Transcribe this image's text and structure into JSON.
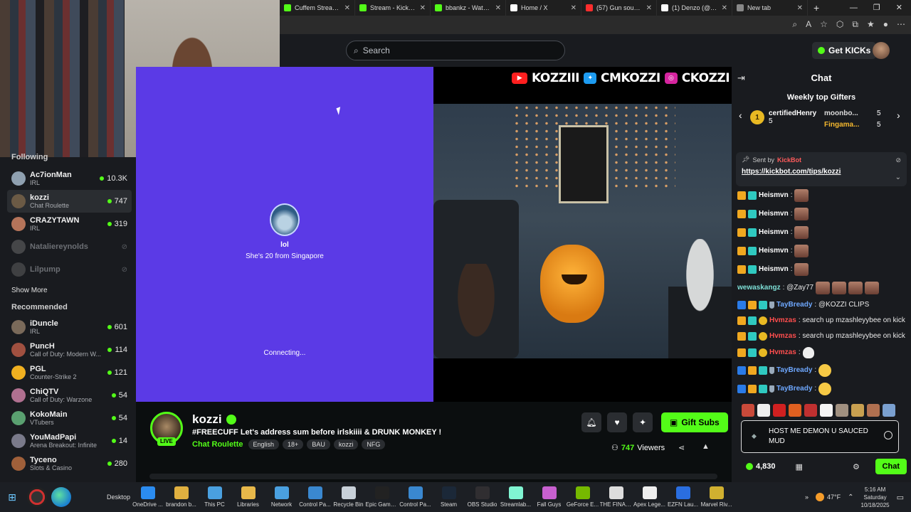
{
  "browser": {
    "tabs": [
      {
        "title": "Cuffem Stream - V",
        "color": "#53fc18"
      },
      {
        "title": "Stream - Kick Dash",
        "color": "#53fc18"
      },
      {
        "title": "bbankz - Watch th",
        "color": "#53fc18"
      },
      {
        "title": "Home / X",
        "color": "#ffffff"
      },
      {
        "title": "(57) Gun sound ef",
        "color": "#ff2d2d"
      },
      {
        "title": "(1) Denzo (@Denz",
        "color": "#ffffff"
      },
      {
        "title": "New tab",
        "color": "#888888"
      }
    ]
  },
  "header": {
    "search_placeholder": "Search",
    "get_kicks": "Get KICKs"
  },
  "sidebar": {
    "following_label": "Following",
    "following": [
      {
        "name": "Ac7ionMan",
        "category": "IRL",
        "viewers": "10.3K",
        "live": true,
        "color": "#8fa0b0"
      },
      {
        "name": "kozzi",
        "category": "Chat Roulette",
        "viewers": "747",
        "live": true,
        "color": "#6b5a45"
      },
      {
        "name": "CRAZYTAWN",
        "category": "IRL",
        "viewers": "319",
        "live": true,
        "color": "#b5745a"
      },
      {
        "name": "Nataliereynolds",
        "category": "",
        "viewers": "",
        "live": false,
        "color": "#888"
      },
      {
        "name": "Lilpump",
        "category": "",
        "viewers": "",
        "live": false,
        "color": "#777"
      }
    ],
    "show_more": "Show More",
    "recommended_label": "Recommended",
    "recommended": [
      {
        "name": "iDuncle",
        "category": "IRL",
        "viewers": "601",
        "color": "#7a6a5a"
      },
      {
        "name": "PuncH",
        "category": "Call of Duty: Modern W...",
        "viewers": "114",
        "color": "#a05040"
      },
      {
        "name": "PGL",
        "category": "Counter-Strike 2",
        "viewers": "121",
        "color": "#f0b020"
      },
      {
        "name": "ChiQTV",
        "category": "Call of Duty: Warzone",
        "viewers": "54",
        "color": "#b07090"
      },
      {
        "name": "KokoMain",
        "category": "VTubers",
        "viewers": "54",
        "color": "#5aa070"
      },
      {
        "name": "YouMadPapi",
        "category": "Arena Breakout: Infinite",
        "viewers": "14",
        "color": "#7a7a8a"
      },
      {
        "name": "Tyceno",
        "category": "Slots & Casino",
        "viewers": "280",
        "color": "#a0603a"
      }
    ]
  },
  "stream": {
    "roulette_name": "lol",
    "roulette_sub": "She's 20 from Singapore",
    "roulette_status": "Connecting...",
    "social_youtube": "KOZZIII",
    "social_twitter": "CMKOZZI",
    "social_instagram": "CKOZZI"
  },
  "info": {
    "streamer": "kozzi",
    "live_label": "LIVE",
    "title": "#FREECUFF Let's address sum before irlskiiii  & DRUNK MONKEY !",
    "category": "Chat Roulette",
    "tags": [
      "English",
      "18+",
      "BAU",
      "kozzi",
      "NFG"
    ],
    "gift_subs": "Gift Subs",
    "viewer_count": "747",
    "viewers_label": "Viewers"
  },
  "chat": {
    "title": "Chat",
    "weekly_title": "Weekly top Gifters",
    "gifter1": {
      "rank": "1",
      "name": "certifiedHenry",
      "count": "5"
    },
    "gifter2": {
      "name": "moonbo...",
      "count": "5"
    },
    "gifter3": {
      "name": "Fingama...",
      "count": "5"
    },
    "pinned_by_label": "Sent by",
    "pinned_user": "KickBot",
    "pinned_link": "https://kickbot.com/tips/kozzi",
    "messages": [
      {
        "user": "Heismvn",
        "text": ":"
      },
      {
        "user": "Heismvn",
        "text": ":"
      },
      {
        "user": "Heismvn",
        "text": ":"
      },
      {
        "user": "Heismvn",
        "text": ":"
      },
      {
        "user": "Heismvn",
        "text": ":"
      },
      {
        "user": "wewaskangz",
        "text": ": @Zay77"
      },
      {
        "user": "TayBready",
        "text": ": @KOZZI CLIPS"
      },
      {
        "user": "Hvmzas",
        "text": ": search up mzashleyybee on kick"
      },
      {
        "user": "Hvmzas",
        "text": ": search up mzashleyybee on kick"
      },
      {
        "user": "Hvmzas",
        "text": ":"
      },
      {
        "user": "TayBready",
        "text": ":"
      },
      {
        "user": "TayBready",
        "text": ":"
      }
    ],
    "input_text": "HOST ME DEMON U SAUCED MUD",
    "points": "4,830",
    "send_label": "Chat"
  },
  "taskbar": {
    "desktop_label": "Desktop",
    "apps": [
      {
        "label": "OneDrive ...",
        "color": "#2b8cf0"
      },
      {
        "label": "brandon b...",
        "color": "#e0b040"
      },
      {
        "label": "This PC",
        "color": "#4aa0e0"
      },
      {
        "label": "Libraries",
        "color": "#e8b84a"
      },
      {
        "label": "Network",
        "color": "#4aa0e0"
      },
      {
        "label": "Control Pa...",
        "color": "#3a88d0"
      },
      {
        "label": "Recycle Bin",
        "color": "#c8d0d8"
      },
      {
        "label": "Epic Game...",
        "color": "#222222"
      },
      {
        "label": "Control Pa...",
        "color": "#3a88d0"
      },
      {
        "label": "Steam",
        "color": "#1b2838"
      },
      {
        "label": "OBS Studio",
        "color": "#302e31"
      },
      {
        "label": "Streamlab...",
        "color": "#80f5d2"
      },
      {
        "label": "Fall Guys",
        "color": "#c860d0"
      },
      {
        "label": "GeForce E...",
        "color": "#76b900"
      },
      {
        "label": "THE FINALS",
        "color": "#dddddd"
      },
      {
        "label": "Apex Lege...",
        "color": "#eeeeee"
      },
      {
        "label": "EZFN Lau...",
        "color": "#2a6ee0"
      },
      {
        "label": "Marvel Riv...",
        "color": "#d0b030"
      }
    ],
    "temperature": "47°F",
    "time": "5:16 AM",
    "day": "Saturday",
    "date": "10/18/2025"
  }
}
